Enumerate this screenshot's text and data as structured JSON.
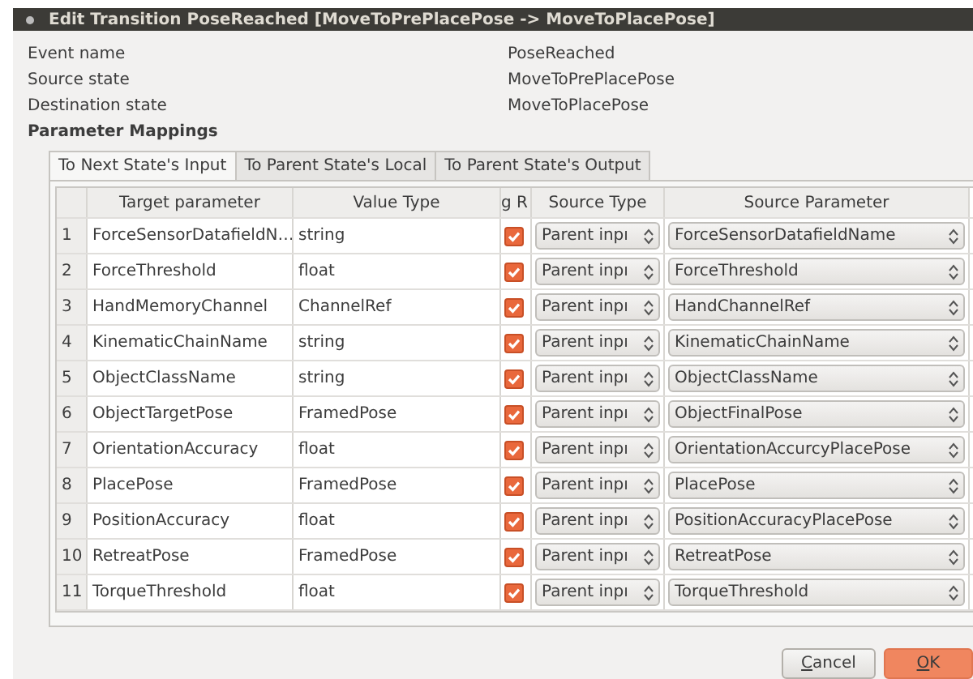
{
  "window": {
    "title": "Edit Transition PoseReached [MoveToPrePlacePose -> MoveToPlacePose]"
  },
  "fields": [
    {
      "label": "Event name",
      "value": "PoseReached"
    },
    {
      "label": "Source state",
      "value": "MoveToPrePlacePose"
    },
    {
      "label": "Destination state",
      "value": "MoveToPlacePose"
    }
  ],
  "section_title": "Parameter Mappings",
  "tabs": [
    {
      "label": "To Next State's Input",
      "selected": true
    },
    {
      "label": "To Parent State's Local",
      "selected": false
    },
    {
      "label": "To Parent State's Output",
      "selected": false
    }
  ],
  "table": {
    "columns": [
      "Target parameter",
      "Value Type",
      "g R",
      "Source Type",
      "Source Parameter"
    ],
    "rows": [
      {
        "index": "1",
        "target": "ForceSensorDatafieldN…",
        "type": "string",
        "checked": true,
        "source_type": "Parent inpı",
        "source_param": "ForceSensorDatafieldName"
      },
      {
        "index": "2",
        "target": "ForceThreshold",
        "type": "float",
        "checked": true,
        "source_type": "Parent inpı",
        "source_param": "ForceThreshold"
      },
      {
        "index": "3",
        "target": "HandMemoryChannel",
        "type": "ChannelRef",
        "checked": true,
        "source_type": "Parent inpı",
        "source_param": "HandChannelRef"
      },
      {
        "index": "4",
        "target": "KinematicChainName",
        "type": "string",
        "checked": true,
        "source_type": "Parent inpı",
        "source_param": "KinematicChainName"
      },
      {
        "index": "5",
        "target": "ObjectClassName",
        "type": "string",
        "checked": true,
        "source_type": "Parent inpı",
        "source_param": "ObjectClassName"
      },
      {
        "index": "6",
        "target": "ObjectTargetPose",
        "type": "FramedPose",
        "checked": true,
        "source_type": "Parent inpı",
        "source_param": "ObjectFinalPose"
      },
      {
        "index": "7",
        "target": "OrientationAccuracy",
        "type": "float",
        "checked": true,
        "source_type": "Parent inpı",
        "source_param": "OrientationAccurcyPlacePose"
      },
      {
        "index": "8",
        "target": "PlacePose",
        "type": "FramedPose",
        "checked": true,
        "source_type": "Parent inpı",
        "source_param": "PlacePose"
      },
      {
        "index": "9",
        "target": "PositionAccuracy",
        "type": "float",
        "checked": true,
        "source_type": "Parent inpı",
        "source_param": "PositionAccuracyPlacePose"
      },
      {
        "index": "10",
        "target": "RetreatPose",
        "type": "FramedPose",
        "checked": true,
        "source_type": "Parent inpı",
        "source_param": "RetreatPose"
      },
      {
        "index": "11",
        "target": "TorqueThreshold",
        "type": "float",
        "checked": true,
        "source_type": "Parent inpı",
        "source_param": "TorqueThreshold"
      }
    ]
  },
  "buttons": [
    {
      "label": "Cancel",
      "kind": "default",
      "mnemonic_underlined": true
    },
    {
      "label": "OK",
      "kind": "primary",
      "mnemonic_underlined": true
    }
  ]
}
